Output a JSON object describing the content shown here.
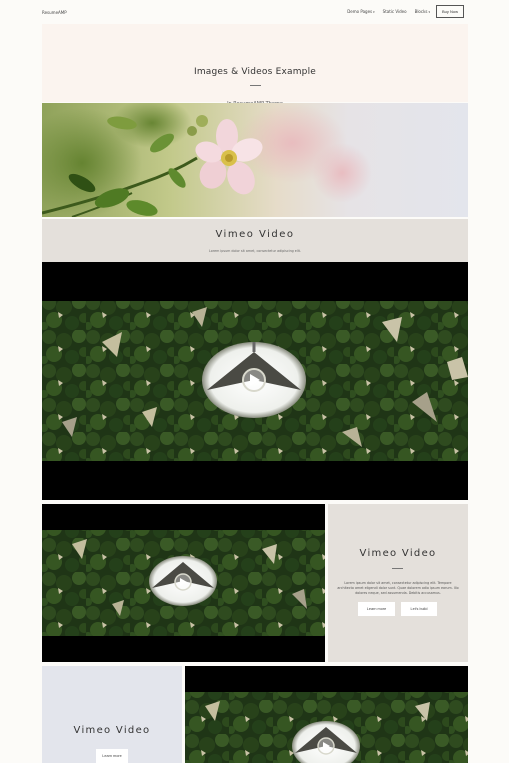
{
  "nav": {
    "logo": "ResumeAMP",
    "items": [
      {
        "label": "Demo Pages",
        "has_caret": true
      },
      {
        "label": "Static Video",
        "has_caret": false
      },
      {
        "label": "Blocks",
        "has_caret": true
      }
    ],
    "buy_label": "Buy Now"
  },
  "hero": {
    "title": "Images & Videos Example",
    "subtitle": "In ResumeAMP Theme"
  },
  "vimeo_section": {
    "title": "Vimeo Video",
    "subtitle": "Lorem ipsum dolor sit amet, consectetur adipiscing elit."
  },
  "card_right": {
    "title": "Vimeo Video",
    "text": "Lorem ipsum dolor sit amet, consectetur adipiscing elit. Tempore architecto amet eligendi dolor sunt. Quae dolorem odio ipsum earum. Illo dolores neque, sed assumenda. Debitis accusamus.",
    "button1": "Learn more",
    "button2": "Let's build"
  },
  "card_left": {
    "title": "Vimeo Video",
    "button": "Learn more"
  },
  "colors": {
    "hero_bg": "#fbf4ef",
    "taupe": "#e4e0db",
    "lavender": "#e3e5ec"
  }
}
